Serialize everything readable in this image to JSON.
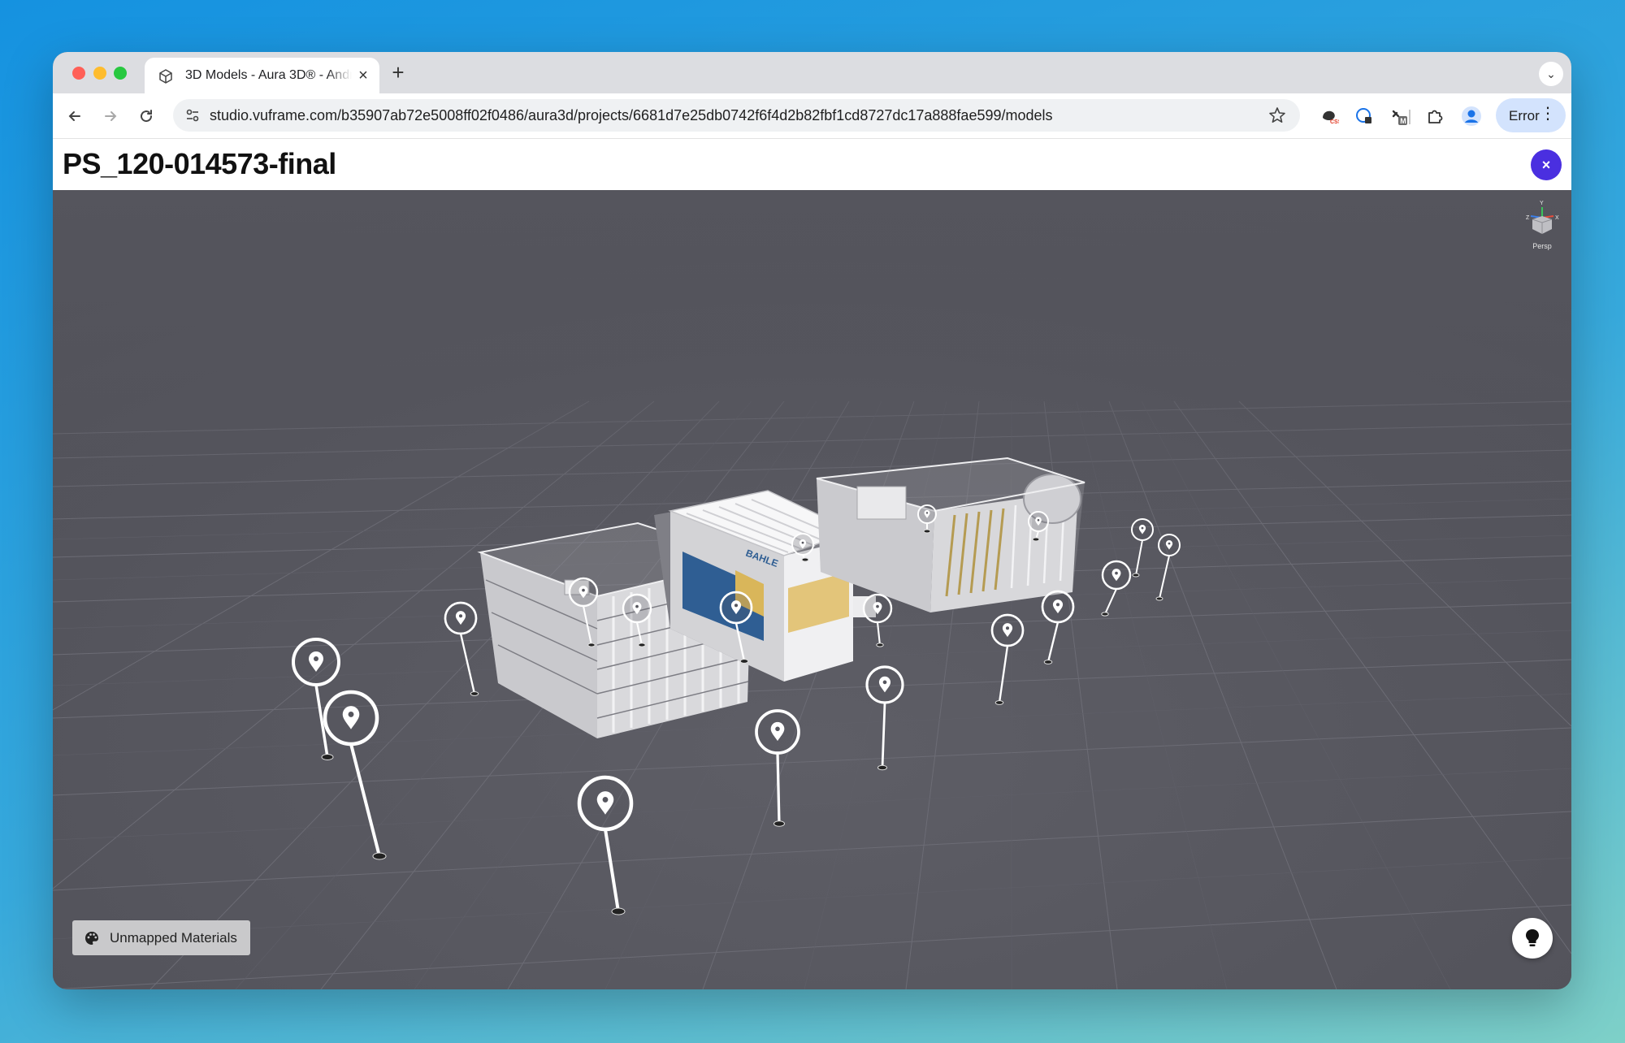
{
  "browser": {
    "tab": {
      "title": "3D Models - Aura 3D® - Andr",
      "icon": "cube-icon",
      "close": "×"
    },
    "new_tab": "+",
    "tab_menu": "⌄",
    "url": "studio.vuframe.com/b35907ab72e5008ff02f0486/aura3d/projects/6681d7e25db0742f6f4d2b82fbf1cd8727dc17a888fae599/models",
    "profile_button": {
      "label": "Error",
      "menu": "⋮"
    },
    "extension_badge": "M"
  },
  "page": {
    "title": "PS_120-014573-final",
    "close_label": "×"
  },
  "viewport": {
    "background": "#55555d",
    "camera_mode": "Persp",
    "gizmo_axes": {
      "x": "X",
      "y": "Y",
      "z": "Z"
    },
    "unmapped_button": "Unmapped Materials",
    "hotspot_count": 18,
    "model_label": "BAHLE"
  },
  "colors": {
    "accent": "#4a2fe0",
    "profile_pill": "#d3e3fd",
    "hotspot": "#ffffff"
  }
}
